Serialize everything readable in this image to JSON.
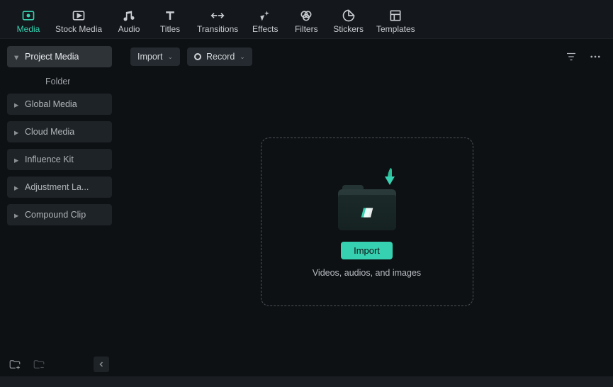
{
  "colors": {
    "accent": "#36d1b0"
  },
  "top_tabs": [
    {
      "id": "media",
      "label": "Media",
      "active": true
    },
    {
      "id": "stock-media",
      "label": "Stock Media",
      "active": false
    },
    {
      "id": "audio",
      "label": "Audio",
      "active": false
    },
    {
      "id": "titles",
      "label": "Titles",
      "active": false
    },
    {
      "id": "transitions",
      "label": "Transitions",
      "active": false
    },
    {
      "id": "effects",
      "label": "Effects",
      "active": false
    },
    {
      "id": "filters",
      "label": "Filters",
      "active": false
    },
    {
      "id": "stickers",
      "label": "Stickers",
      "active": false
    },
    {
      "id": "templates",
      "label": "Templates",
      "active": false
    }
  ],
  "sidebar": {
    "items": [
      {
        "id": "project-media",
        "label": "Project Media",
        "state": "expanded"
      },
      {
        "id": "folder",
        "label": "Folder",
        "state": "child"
      },
      {
        "id": "global-media",
        "label": "Global Media",
        "state": "collapsed"
      },
      {
        "id": "cloud-media",
        "label": "Cloud Media",
        "state": "collapsed"
      },
      {
        "id": "influence-kit",
        "label": "Influence Kit",
        "state": "collapsed"
      },
      {
        "id": "adjustment-layer",
        "label": "Adjustment La...",
        "state": "collapsed"
      },
      {
        "id": "compound-clip",
        "label": "Compound Clip",
        "state": "collapsed"
      }
    ]
  },
  "content_toolbar": {
    "import_label": "Import",
    "record_label": "Record"
  },
  "drop_zone": {
    "button_label": "Import",
    "hint": "Videos, audios, and images"
  }
}
